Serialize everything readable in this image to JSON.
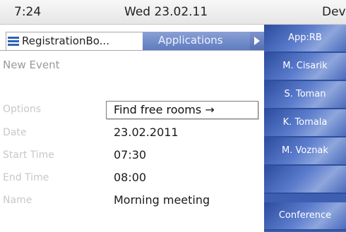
{
  "status": {
    "time": "7:24",
    "date": "Wed 23.02.11",
    "device": "Dev"
  },
  "tabs": [
    {
      "label": "RegistrationBo..."
    },
    {
      "label": "Applications"
    }
  ],
  "form": {
    "title": "New Event",
    "fields": [
      {
        "label": "Options",
        "value": "Find free rooms →"
      },
      {
        "label": "Date",
        "value": "23.02.2011"
      },
      {
        "label": "Start Time",
        "value": "07:30"
      },
      {
        "label": "End Time",
        "value": "08:00"
      },
      {
        "label": "Name",
        "value": "Morning meeting"
      }
    ]
  },
  "sidebar": {
    "buttons": [
      {
        "label": "App:RB"
      },
      {
        "label": "M. Cisarik"
      },
      {
        "label": "S. Toman"
      },
      {
        "label": "K. Tomala"
      },
      {
        "label": "M. Voznak"
      },
      {
        "label": ""
      },
      {
        "label": "Conference"
      }
    ]
  },
  "colors": {
    "accent": "#3e5fb1",
    "tab_active_bg": "#ffffff",
    "label_gray": "#c8c8c8"
  }
}
